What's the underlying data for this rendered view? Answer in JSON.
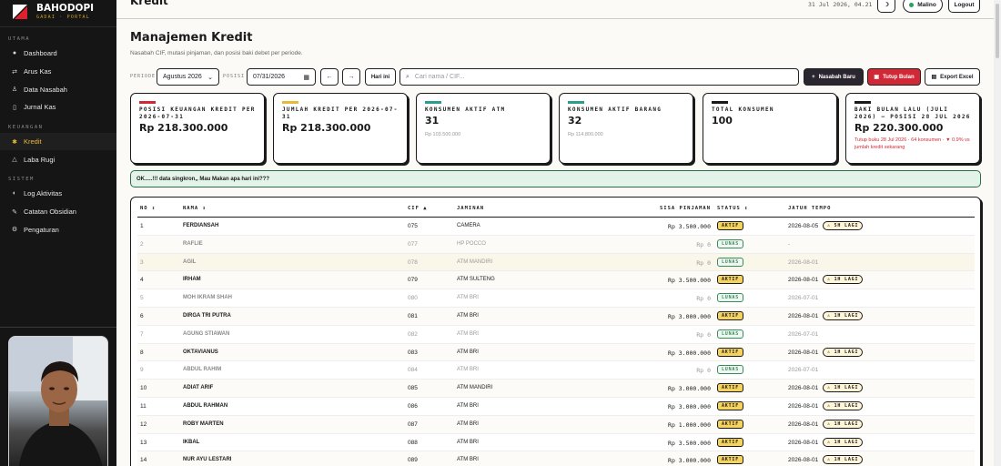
{
  "app": {
    "brand_name": "BAHODOPI",
    "brand_sub": "GADAI · PORTAL"
  },
  "sidebar": {
    "sections": [
      {
        "label": "UTAMA",
        "items": [
          {
            "label": "Dashboard",
            "icon": "circle-dot-icon"
          },
          {
            "label": "Arus Kas",
            "icon": "swap-arrows-icon"
          },
          {
            "label": "Data Nasabah",
            "icon": "person-icon"
          },
          {
            "label": "Jurnal Kas",
            "icon": "book-icon"
          }
        ]
      },
      {
        "label": "KEUANGAN",
        "items": [
          {
            "label": "Kredit",
            "icon": "star-icon",
            "active": true
          },
          {
            "label": "Laba Rugi",
            "icon": "triangle-icon"
          }
        ]
      },
      {
        "label": "SISTEM",
        "items": [
          {
            "label": "Log Aktivitas",
            "icon": "half-circle-icon"
          },
          {
            "label": "Catatan Obsidian",
            "icon": "pen-icon"
          },
          {
            "label": "Pengaturan",
            "icon": "gear-icon"
          }
        ]
      }
    ]
  },
  "topbar": {
    "title": "Kredit",
    "datetime": "31 Jul 2026, 04.21",
    "theme_icon": "moon-icon",
    "user": "Malino",
    "logout": "Logout"
  },
  "page": {
    "heading": "Manajemen Kredit",
    "subheading": "Nasabah CIF, mutasi pinjaman, dan posisi baki debet per periode."
  },
  "filters": {
    "periode_label": "PERIODE",
    "periode_value": "Agustus 2026",
    "posisi_label": "POSISI",
    "posisi_value": "07/31/2026",
    "prev": "←",
    "next": "→",
    "today": "Hari ini",
    "search_placeholder": "Cari nama / CIF...",
    "new_label": "Nasabah Baru",
    "close_label": "Tutup Bulan",
    "export_label": "Export Excel"
  },
  "cards": [
    {
      "label": "POSISI KEUANGAN KREDIT PER 2026-07-31",
      "value": "Rp 218.300.000",
      "sub": "",
      "note": "",
      "color": "#d12836"
    },
    {
      "label": "JUMLAH KREDIT PER 2026-07-31",
      "value": "Rp 218.300.000",
      "sub": "",
      "note": "",
      "color": "#e8b93a"
    },
    {
      "label": "KONSUMEN AKTIF ATM",
      "value": "31",
      "sub": "Rp 103.500.000",
      "note": "",
      "color": "#2a9d8f"
    },
    {
      "label": "KONSUMEN AKTIF BARANG",
      "value": "32",
      "sub": "Rp 114.800.000",
      "note": "",
      "color": "#2a9d8f"
    },
    {
      "label": "TOTAL KONSUMEN",
      "value": "100",
      "sub": "",
      "note": "",
      "color": "#1a1a1a"
    },
    {
      "label": "BAKI BULAN LALU (JULI 2026) — POSISI 28 JUL 2026",
      "value": "Rp 220.300.000",
      "sub": "",
      "note": "Tutup buku 28 Jul 2026 · 64 konsumen · ▼ 0.9% vs jumlah kredit sekarang",
      "color": "#1a1a1a"
    }
  ],
  "alert": "OK.....!!! data singkron,, Mau Makan apa hari ini???",
  "table": {
    "headers": {
      "no": "NO ↕",
      "nama": "NAMA ↕",
      "cif": "CIF ▲",
      "jaminan": "JAMINAN",
      "sisa": "SISA PINJAMAN",
      "status": "STATUS ↕",
      "jatuh": "JATUH TEMPO"
    },
    "rows": [
      {
        "no": "1",
        "nama": "FERDIANSAH",
        "cif": "075",
        "jaminan": "CAMERA",
        "sisa": "Rp 3.500.000",
        "status": "AKTIF",
        "jatuh": "2026-08-05",
        "due": "⚠ 5H LAGI"
      },
      {
        "no": "2",
        "nama": "RAFLIE",
        "cif": "077",
        "jaminan": "HP POCCO",
        "sisa": "Rp 0",
        "status": "LUNAS",
        "jatuh": "-",
        "due": ""
      },
      {
        "no": "3",
        "nama": "AGIL",
        "cif": "078",
        "jaminan": "ATM MANDIRI",
        "sisa": "Rp 0",
        "status": "LUNAS",
        "jatuh": "2026-08-01",
        "due": ""
      },
      {
        "no": "4",
        "nama": "IRHAM",
        "cif": "079",
        "jaminan": "ATM SULTENG",
        "sisa": "Rp 3.500.000",
        "status": "AKTIF",
        "jatuh": "2026-08-01",
        "due": "⚠ 1H LAGI"
      },
      {
        "no": "5",
        "nama": "MOH IKRAM SHAH",
        "cif": "080",
        "jaminan": "ATM BRI",
        "sisa": "Rp 0",
        "status": "LUNAS",
        "jatuh": "2026-07-01",
        "due": ""
      },
      {
        "no": "6",
        "nama": "DIRGA TRI PUTRA",
        "cif": "081",
        "jaminan": "ATM BRI",
        "sisa": "Rp 3.000.000",
        "status": "AKTIF",
        "jatuh": "2026-08-01",
        "due": "⚠ 1H LAGI"
      },
      {
        "no": "7",
        "nama": "AGUNG STIAWAN",
        "cif": "082",
        "jaminan": "ATM BRI",
        "sisa": "Rp 0",
        "status": "LUNAS",
        "jatuh": "2026-07-01",
        "due": ""
      },
      {
        "no": "8",
        "nama": "OKTAVIANUS",
        "cif": "083",
        "jaminan": "ATM BRI",
        "sisa": "Rp 3.000.000",
        "status": "AKTIF",
        "jatuh": "2026-08-01",
        "due": "⚠ 1H LAGI"
      },
      {
        "no": "9",
        "nama": "ABDUL RAHIM",
        "cif": "084",
        "jaminan": "ATM BRI",
        "sisa": "Rp 0",
        "status": "LUNAS",
        "jatuh": "2026-07-01",
        "due": ""
      },
      {
        "no": "10",
        "nama": "ADIAT ARIF",
        "cif": "085",
        "jaminan": "ATM MANDIRI",
        "sisa": "Rp 3.000.000",
        "status": "AKTIF",
        "jatuh": "2026-08-01",
        "due": "⚠ 1H LAGI"
      },
      {
        "no": "11",
        "nama": "ABDUL RAHMAN",
        "cif": "086",
        "jaminan": "ATM BRI",
        "sisa": "Rp 3.000.000",
        "status": "AKTIF",
        "jatuh": "2026-08-01",
        "due": "⚠ 1H LAGI"
      },
      {
        "no": "12",
        "nama": "ROBY MARTEN",
        "cif": "087",
        "jaminan": "ATM BRI",
        "sisa": "Rp 1.000.000",
        "status": "AKTIF",
        "jatuh": "2026-08-01",
        "due": "⚠ 1H LAGI"
      },
      {
        "no": "13",
        "nama": "IKBAL",
        "cif": "088",
        "jaminan": "ATM BRI",
        "sisa": "Rp 3.500.000",
        "status": "AKTIF",
        "jatuh": "2026-08-01",
        "due": "⚠ 1H LAGI"
      },
      {
        "no": "14",
        "nama": "NUR AYU LESTARI",
        "cif": "089",
        "jaminan": "ATM BRI",
        "sisa": "Rp 3.000.000",
        "status": "AKTIF",
        "jatuh": "2026-08-01",
        "due": "⚠ 1H LAGI"
      }
    ]
  }
}
